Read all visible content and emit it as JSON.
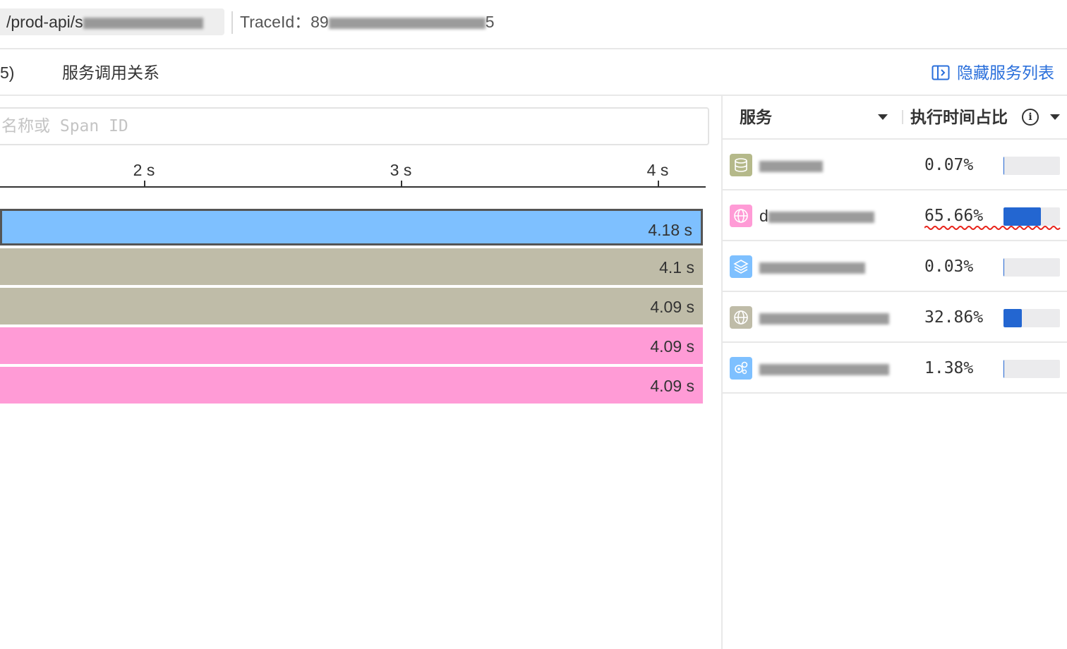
{
  "header": {
    "path_prefix": "/prod-api/s",
    "trace_label": "TraceId：89",
    "trace_suffix": "5"
  },
  "tabs": {
    "left_partial": "5)",
    "call_relation": "服务调用关系",
    "hide_service_list": "隐藏服务列表"
  },
  "search": {
    "placeholder": "名称或 Span ID"
  },
  "timeline": {
    "ticks": [
      "2 s",
      "3 s",
      "4 s"
    ]
  },
  "spans": [
    {
      "duration": "4.18 s",
      "color": "#7ec0ff",
      "selected": true
    },
    {
      "duration": "4.1 s",
      "color": "#bfbca8",
      "selected": false
    },
    {
      "duration": "4.09 s",
      "color": "#bfbca8",
      "selected": false
    },
    {
      "duration": "4.09 s",
      "color": "#ff9bd6",
      "selected": false
    },
    {
      "duration": "4.09 s",
      "color": "#ff9bd6",
      "selected": false
    }
  ],
  "service_panel": {
    "col_service": "服务",
    "col_exec_ratio": "执行时间占比",
    "info_glyph": "i",
    "services": [
      {
        "icon": "database-icon",
        "icon_color": "#b5b98a",
        "name_visible": "",
        "percent": "0.07%",
        "ratio": 0.0007
      },
      {
        "icon": "globe-icon",
        "icon_color": "#ff9bd6",
        "name_visible": "d",
        "percent": "65.66%",
        "ratio": 0.6566
      },
      {
        "icon": "layers-icon",
        "icon_color": "#7ec0ff",
        "name_visible": "",
        "percent": "0.03%",
        "ratio": 0.0003
      },
      {
        "icon": "globe-icon",
        "icon_color": "#bfbca8",
        "name_visible": "",
        "percent": "32.86%",
        "ratio": 0.3286
      },
      {
        "icon": "gears-icon",
        "icon_color": "#7ec0ff",
        "name_visible": "",
        "percent": "1.38%",
        "ratio": 0.0138
      }
    ]
  }
}
